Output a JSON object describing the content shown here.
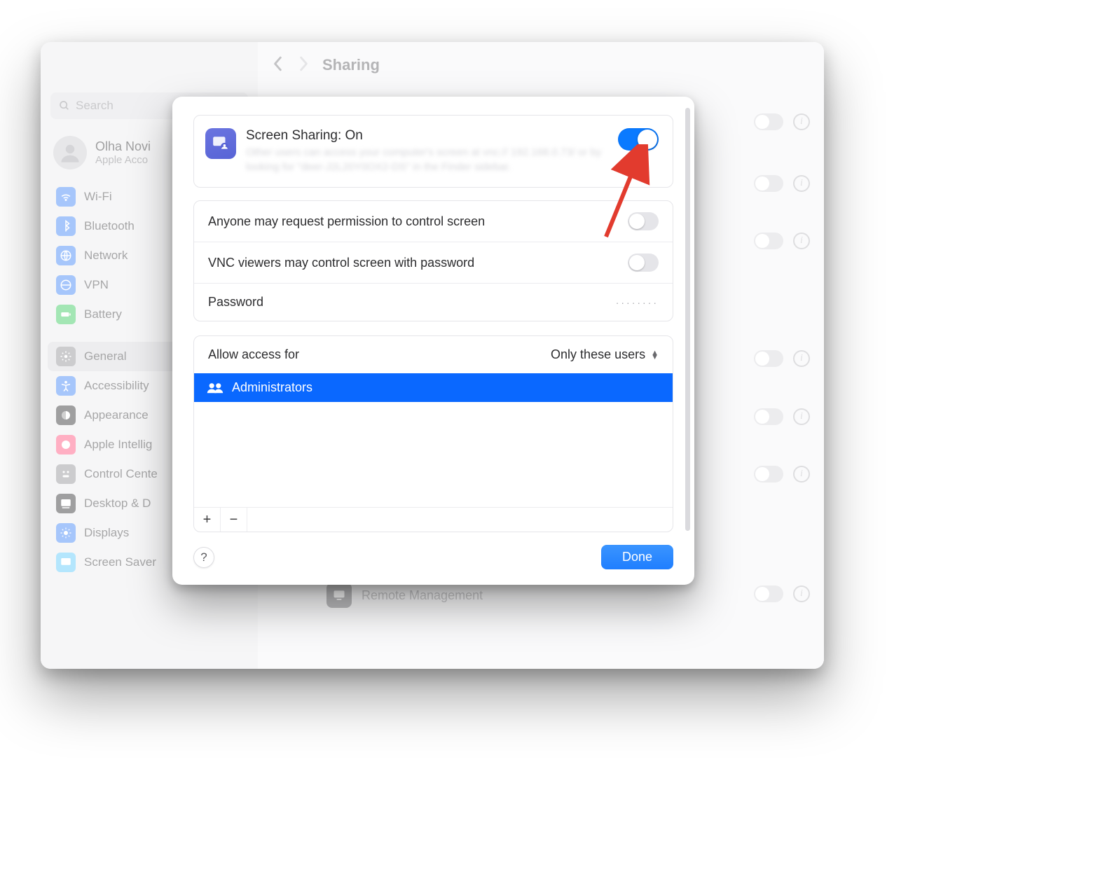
{
  "window": {
    "title": "Sharing",
    "search_placeholder": "Search",
    "user": {
      "name": "Olha Novi",
      "sub": "Apple Acco"
    }
  },
  "sidebar": {
    "items": [
      {
        "label": "Wi-Fi",
        "name": "sidebar-item-wifi",
        "color": "#3a82f7",
        "icon": "wifi"
      },
      {
        "label": "Bluetooth",
        "name": "sidebar-item-bluetooth",
        "color": "#3a82f7",
        "icon": "bluetooth"
      },
      {
        "label": "Network",
        "name": "sidebar-item-network",
        "color": "#3a82f7",
        "icon": "network"
      },
      {
        "label": "VPN",
        "name": "sidebar-item-vpn",
        "color": "#3a82f7",
        "icon": "vpn"
      },
      {
        "label": "Battery",
        "name": "sidebar-item-battery",
        "color": "#34c759",
        "icon": "battery"
      },
      {
        "label": "General",
        "name": "sidebar-item-general",
        "color": "#8e8e93",
        "icon": "gear",
        "active": true
      },
      {
        "label": "Accessibility",
        "name": "sidebar-item-accessibility",
        "color": "#3a82f7",
        "icon": "accessibility"
      },
      {
        "label": "Appearance",
        "name": "sidebar-item-appearance",
        "color": "#2c2c2e",
        "icon": "appearance"
      },
      {
        "label": "Apple Intellig",
        "name": "sidebar-item-apple-intel",
        "color": "#ff4f7b",
        "icon": "ai"
      },
      {
        "label": "Control Cente",
        "name": "sidebar-item-control-center",
        "color": "#8e8e93",
        "icon": "control"
      },
      {
        "label": "Desktop & D",
        "name": "sidebar-item-desktop-dock",
        "color": "#2c2c2e",
        "icon": "dock"
      },
      {
        "label": "Displays",
        "name": "sidebar-item-displays",
        "color": "#3a82f7",
        "icon": "displays"
      },
      {
        "label": "Screen Saver",
        "name": "sidebar-item-screen-saver",
        "color": "#5ac8fa",
        "icon": "screensaver"
      }
    ]
  },
  "bg_row_label": "Remote Management",
  "modal": {
    "title": "Screen Sharing: On",
    "subtitle": "Other users can access your computer's screen at vnc:// 192.168.0.73/ or by looking for \"deer-J2L20Y0OX2-DS\" in the Finder sidebar.",
    "rows": {
      "anyone": {
        "label": "Anyone may request permission to control screen",
        "on": false
      },
      "vnc": {
        "label": "VNC viewers may control screen with password",
        "on": false
      },
      "password": {
        "label": "Password",
        "value": "········"
      }
    },
    "access": {
      "label": "Allow access for",
      "selected": "Only these users",
      "list": [
        {
          "label": "Administrators"
        }
      ],
      "add_label": "+",
      "remove_label": "−"
    },
    "help_label": "?",
    "done_label": "Done"
  }
}
